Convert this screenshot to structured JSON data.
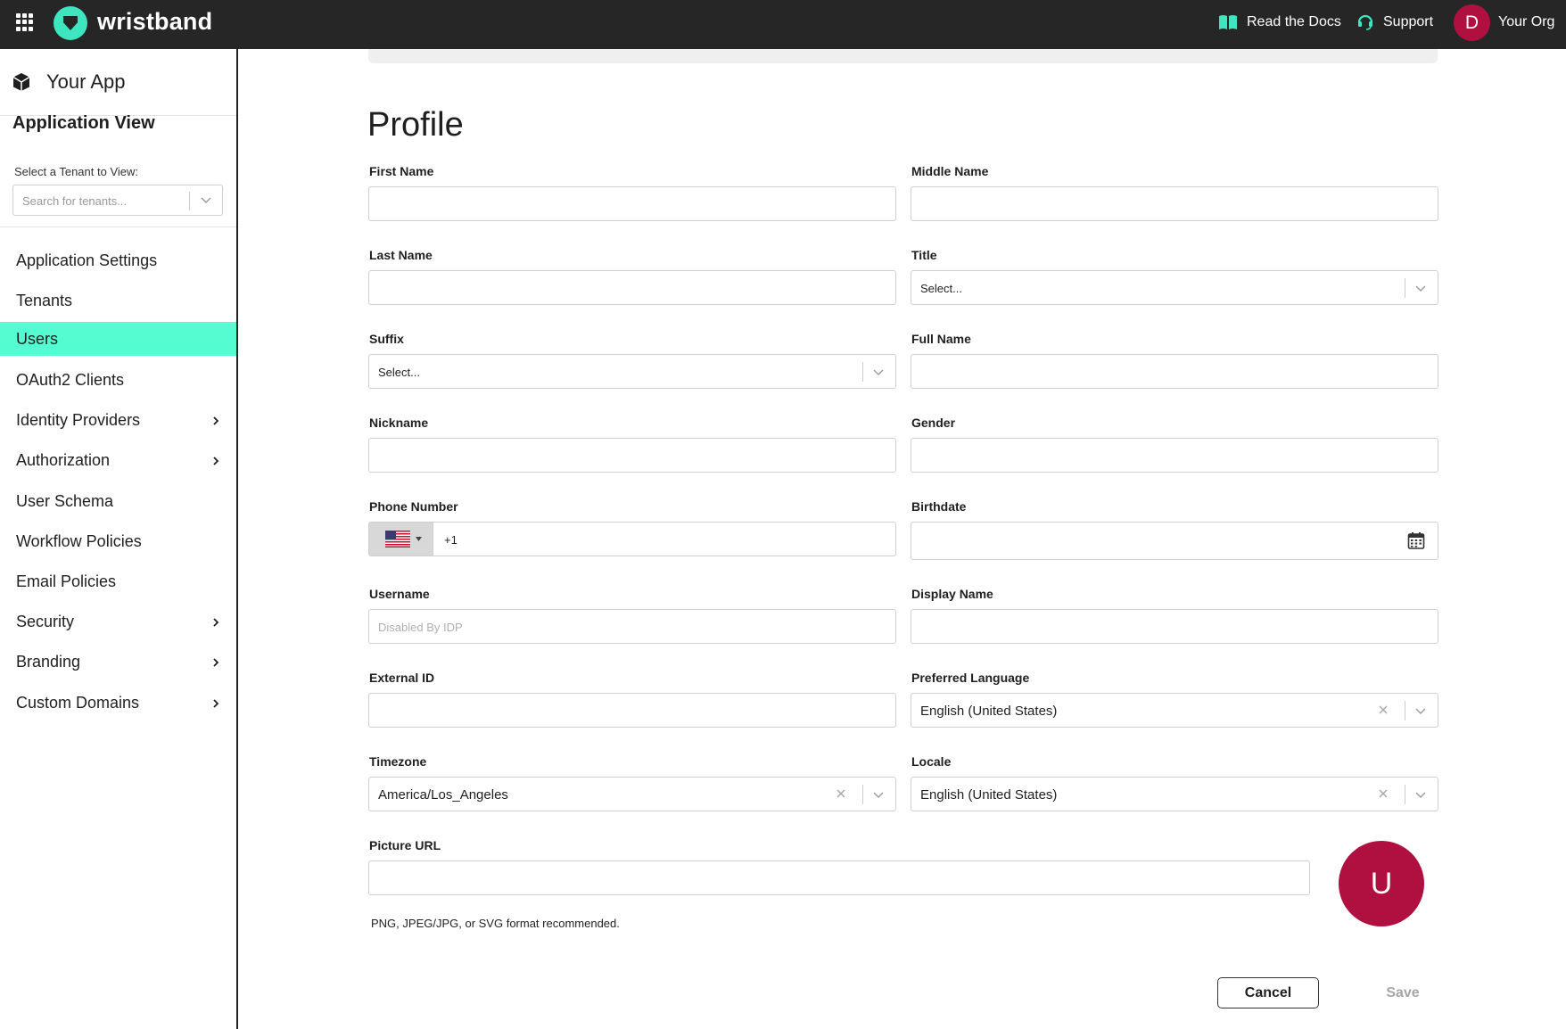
{
  "topbar": {
    "brand": "wristband",
    "docs_label": "Read the Docs",
    "support_label": "Support",
    "org_initial": "D",
    "org_label": "Your Org",
    "accent_color": "#3ee6c0",
    "avatar_color": "#b0103f"
  },
  "sidebar": {
    "app_name": "Your App",
    "app_view_title": "Application View",
    "tenant_select_label": "Select a Tenant to View:",
    "tenant_search_placeholder": "Search for tenants...",
    "active_color": "#56fcd1",
    "items": [
      {
        "label": "Application Settings",
        "has_submenu": false,
        "active": false
      },
      {
        "label": "Tenants",
        "has_submenu": false,
        "active": false
      },
      {
        "label": "Users",
        "has_submenu": false,
        "active": true
      },
      {
        "label": "OAuth2 Clients",
        "has_submenu": false,
        "active": false
      },
      {
        "label": "Identity Providers",
        "has_submenu": true,
        "active": false
      },
      {
        "label": "Authorization",
        "has_submenu": true,
        "active": false
      },
      {
        "label": "User Schema",
        "has_submenu": false,
        "active": false
      },
      {
        "label": "Workflow Policies",
        "has_submenu": false,
        "active": false
      },
      {
        "label": "Email Policies",
        "has_submenu": false,
        "active": false
      },
      {
        "label": "Security",
        "has_submenu": true,
        "active": false
      },
      {
        "label": "Branding",
        "has_submenu": true,
        "active": false
      },
      {
        "label": "Custom Domains",
        "has_submenu": true,
        "active": false
      }
    ]
  },
  "profile": {
    "title": "Profile",
    "fields": {
      "first_name": {
        "label": "First Name",
        "value": ""
      },
      "middle_name": {
        "label": "Middle Name",
        "value": ""
      },
      "last_name": {
        "label": "Last Name",
        "value": ""
      },
      "title": {
        "label": "Title",
        "value": "Select..."
      },
      "suffix": {
        "label": "Suffix",
        "value": "Select..."
      },
      "full_name": {
        "label": "Full Name",
        "value": ""
      },
      "nickname": {
        "label": "Nickname",
        "value": ""
      },
      "gender": {
        "label": "Gender",
        "value": ""
      },
      "phone_number": {
        "label": "Phone Number",
        "country_code": "+1",
        "value": ""
      },
      "birthdate": {
        "label": "Birthdate",
        "value": ""
      },
      "username": {
        "label": "Username",
        "placeholder": "Disabled By IDP"
      },
      "display_name": {
        "label": "Display Name",
        "value": ""
      },
      "external_id": {
        "label": "External ID",
        "value": ""
      },
      "preferred_language": {
        "label": "Preferred Language",
        "value": "English (United States)"
      },
      "timezone": {
        "label": "Timezone",
        "value": "America/Los_Angeles"
      },
      "locale": {
        "label": "Locale",
        "value": "English (United States)"
      },
      "picture_url": {
        "label": "Picture URL",
        "value": "",
        "hint": "PNG, JPEG/JPG, or SVG format recommended."
      }
    },
    "avatar_initial": "U",
    "cancel_label": "Cancel",
    "save_label": "Save"
  }
}
